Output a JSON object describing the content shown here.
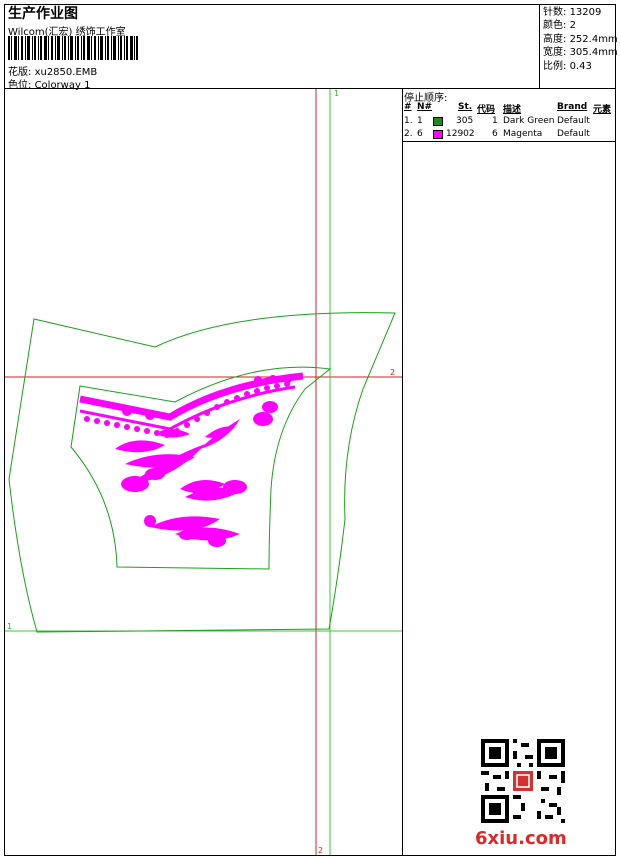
{
  "header": {
    "title": "生产作业图",
    "company": "Wilcom(汇宏) 绣饰工作室",
    "design_label": "花版:",
    "design_file": "xu2850.EMB",
    "colorway_label": "色位:",
    "colorway_name": "Colorway 1"
  },
  "stats": {
    "stitches_label": "针数:",
    "stitches": "13209",
    "colors_label": "颜色:",
    "colors": "2",
    "height_label": "高度:",
    "height": "252.4mm",
    "width_label": "宽度:",
    "width": "305.4mm",
    "scale_label": "比例:",
    "scale": "0.43"
  },
  "stop_sequence": {
    "title": "停止顺序:",
    "headers": {
      "index": "#",
      "number": "N#",
      "stitches": "St.",
      "code": "代码",
      "description": "描述",
      "brand": "Brand",
      "element": "元素"
    },
    "rows": [
      {
        "index": "1.",
        "number": "1",
        "color": "#1a8c1a",
        "stitches": "305",
        "code": "1",
        "description": "Dark Green",
        "brand": "Default"
      },
      {
        "index": "2.",
        "number": "6",
        "color": "#ff00ff",
        "stitches": "12902",
        "code": "6",
        "description": "Magenta",
        "brand": "Default"
      }
    ]
  },
  "axis_labels": {
    "green_top": "1",
    "green_left": "1",
    "red_right": "2",
    "red_bottom": "2"
  },
  "colors": {
    "outline_green": "#1aa01a",
    "guide_green": "#33cc33",
    "guide_red": "#cc2222",
    "embroidery": "#ff00ff"
  },
  "watermark": {
    "text": "6xiu.com"
  }
}
